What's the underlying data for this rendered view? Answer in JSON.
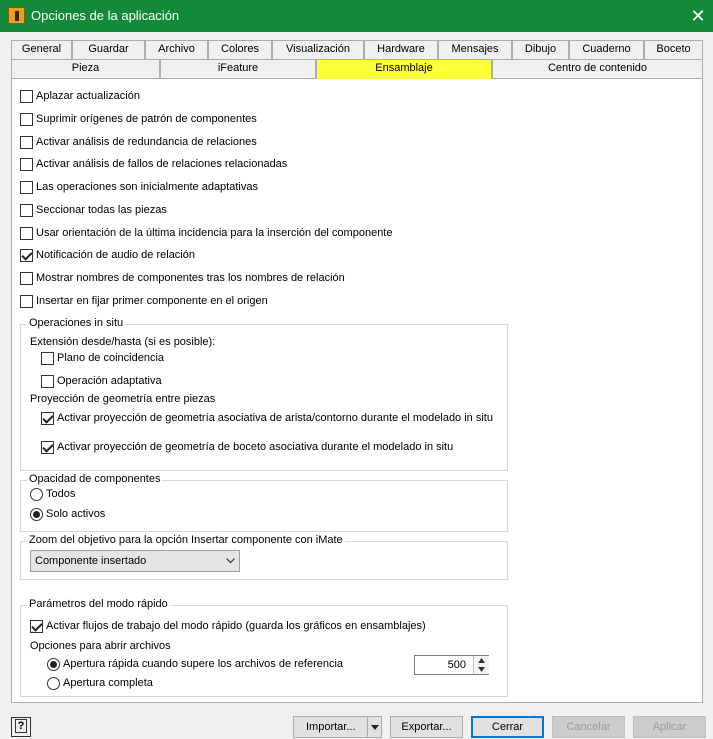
{
  "window": {
    "title": "Opciones de la aplicación",
    "close_glyph": "✕"
  },
  "tabs_row1": [
    "General",
    "Guardar",
    "Archivo",
    "Colores",
    "Visualización",
    "Hardware",
    "Mensajes",
    "Dibujo",
    "Cuaderno",
    "Boceto"
  ],
  "tabs_row2": [
    "Pieza",
    "iFeature",
    "Ensamblaje",
    "Centro de contenido"
  ],
  "active_tab": "Ensamblaje",
  "options": [
    {
      "label": "Aplazar actualización",
      "checked": false
    },
    {
      "label": "Suprimir orígenes de patrón de componentes",
      "checked": false
    },
    {
      "label": "Activar análisis de redundancia de relaciones",
      "checked": false
    },
    {
      "label": "Activar análisis de fallos de relaciones relacionadas",
      "checked": false
    },
    {
      "label": "Las operaciones son inicialmente adaptativas",
      "checked": false
    },
    {
      "label": "Seccionar todas las piezas",
      "checked": false
    },
    {
      "label": "Usar orientación de la última incidencia para la inserción del componente",
      "checked": false
    },
    {
      "label": "Notificación de audio de relación",
      "checked": true
    },
    {
      "label": "Mostrar nombres de componentes tras los nombres de relación",
      "checked": false
    },
    {
      "label": "Insertar en fijar primer componente en el origen",
      "checked": false
    }
  ],
  "in_situ": {
    "legend": "Operaciones in situ",
    "extension_label": "Extensión desde/hasta (si es posible):",
    "plano": {
      "label": "Plano de coincidencia",
      "checked": false
    },
    "adaptativa": {
      "label": "Operación adaptativa",
      "checked": false
    },
    "projection_label": "Proyección de geometría entre piezas",
    "proj_edge": {
      "label": "Activar proyección de geometría asociativa de arista/contorno durante el modelado in situ",
      "checked": true
    },
    "proj_sketch": {
      "label": "Activar proyección de geometría de boceto asociativa durante el modelado in situ",
      "checked": true
    }
  },
  "opacity": {
    "legend": "Opacidad de componentes",
    "options": [
      {
        "label": "Todos",
        "selected": false
      },
      {
        "label": "Solo activos",
        "selected": true
      }
    ]
  },
  "zoom": {
    "legend": "Zoom del objetivo para la opción Insertar componente con iMate",
    "selected": "Componente insertado"
  },
  "quick": {
    "legend": "Parámetros del modo rápido",
    "workflows": {
      "label": "Activar flujos de trabajo del modo rápido (guarda los gráficos en ensamblajes)",
      "checked": true
    },
    "open_label": "Opciones para abrir archivos",
    "rapid": {
      "label": "Apertura rápida cuando supere los archivos de referencia",
      "selected": true
    },
    "full": {
      "label": "Apertura completa",
      "selected": false
    },
    "threshold": "500"
  },
  "footer": {
    "help": "?",
    "import": "Importar...",
    "export": "Exportar...",
    "close": "Cerrar",
    "cancel": "Cancelar",
    "apply": "Aplicar"
  }
}
